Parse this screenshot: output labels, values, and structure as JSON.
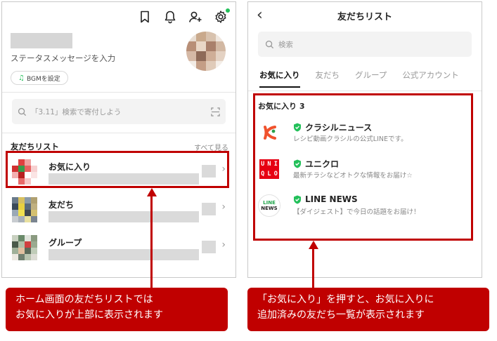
{
  "left_screen": {
    "status_placeholder": "ステータスメッセージを入力",
    "bgm_button": "BGMを設定",
    "search_placeholder": "「3.11」検索で寄付しよう",
    "friends_list_header": "友だちリスト",
    "see_all": "すべて見る",
    "rows": [
      {
        "label": "お気に入り"
      },
      {
        "label": "友だち"
      },
      {
        "label": "グループ"
      }
    ]
  },
  "right_screen": {
    "title": "友だちリスト",
    "search_placeholder": "検索",
    "tabs": [
      {
        "label": "お気に入り",
        "active": true
      },
      {
        "label": "友だち",
        "active": false
      },
      {
        "label": "グループ",
        "active": false
      },
      {
        "label": "公式アカウント",
        "active": false
      }
    ],
    "favorites_header": "お気に入り 3",
    "accounts": [
      {
        "name": "クラシルニュース",
        "desc": "レシピ動画クラシルの公式LINEです。"
      },
      {
        "name": "ユニクロ",
        "desc": "最新チラシなどオトクな情報をお届け☆",
        "logo_text": [
          "U",
          "N",
          "I",
          "Q",
          "L",
          "O"
        ]
      },
      {
        "name": "LINE NEWS",
        "desc": "【ダイジェスト】で今日の話題をお届け！",
        "logo_text": [
          "LINE",
          "NEWS"
        ]
      }
    ]
  },
  "callouts": {
    "left": [
      "ホーム画面の友だちリストでは",
      "お気に入りが上部に表示されます"
    ],
    "right": [
      "「お気に入り」を押すと、お気に入りに",
      "追加済みの友だち一覧が表示されます"
    ]
  },
  "colors": {
    "highlight": "#c00000",
    "line_green": "#23c05a",
    "uniqlo_red": "#e60012",
    "kurashiru_orange": "#f0522d"
  }
}
